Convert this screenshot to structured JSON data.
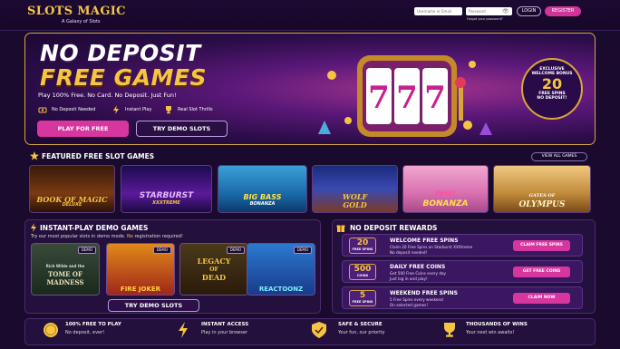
{
  "header": {
    "logo_title": "SLOTS MAGIC",
    "logo_sub": "A Galaxy of Slots",
    "username_placeholder": "Username or Email",
    "password_placeholder": "Password",
    "forgot": "Forgot your password?",
    "login": "LOGIN",
    "register": "REGISTER"
  },
  "hero": {
    "title1": "NO DEPOSIT",
    "title2": "FREE GAMES",
    "subtitle": "Play 100% Free. No Card. No Deposit. Just Fun!",
    "features": [
      "No Deposit Needed",
      "Instant Play",
      "Real Slot Thrills"
    ],
    "play_btn": "PLAY FOR FREE",
    "demo_btn": "TRY DEMO SLOTS",
    "bonus": {
      "l1": "EXCLUSIVE",
      "l2": "WELCOME BONUS",
      "num": "20",
      "l3": "FREE SPINS",
      "l4": "NO DEPOSIT!"
    }
  },
  "featured": {
    "title": "FEATURED FREE SLOT GAMES",
    "view_all": "VIEW ALL GAMES",
    "games": [
      "BOOK OF MAGIC",
      "DELUXE",
      "STARBURST",
      "XXXTREME",
      "BIG BASS",
      "BONANZA",
      "WOLF",
      "GOLD",
      "SWEET",
      "BONANZA",
      "GATES OF",
      "OLYMPUS"
    ]
  },
  "demo": {
    "title": "INSTANT-PLAY DEMO GAMES",
    "desc_a": "Try our most popular slots in demo mode.",
    "desc_no": "No",
    "desc_b": "registration required!",
    "tag": "DEMO",
    "games": [
      "TOME OF",
      "MADNESS",
      "FIRE JOKER",
      "LEGACY",
      "OF",
      "DEAD",
      "REACTOONZ",
      "Rich Wilde and the"
    ],
    "try_btn": "TRY DEMO SLOTS"
  },
  "rewards": {
    "title": "NO DEPOSIT REWARDS",
    "items": [
      {
        "num": "20",
        "unit": "FREE SPINS",
        "title": "WELCOME FREE SPINS",
        "l1": "Claim 20 Free Spins on Starburst XXXtreme",
        "l2": "No deposit needed!",
        "btn": "CLAIM FREE SPINS"
      },
      {
        "num": "500",
        "unit": "COINS",
        "title": "DAILY FREE COINS",
        "l1": "Get 500 Free Coins every day",
        "l2": "Just log in and play!",
        "btn": "GET FREE COINS"
      },
      {
        "num": "5",
        "unit": "FREE SPINS",
        "title": "WEEKEND FREE SPINS",
        "l1": "5 Free Spins every weekend",
        "l2": "On selected games!",
        "btn": "CLAIM NOW"
      }
    ]
  },
  "bottom": [
    {
      "title": "100% FREE TO PLAY",
      "desc": "No deposit, ever!"
    },
    {
      "title": "INSTANT ACCESS",
      "desc": "Play in your browser"
    },
    {
      "title": "SAFE & SECURE",
      "desc": "Your fun, our priority"
    },
    {
      "title": "THOUSANDS OF WINS",
      "desc": "Your next win awaits!"
    }
  ],
  "colors": {
    "accent_pink": "#d7369f",
    "gold": "#f5c542",
    "bg": "#1a0b2e"
  }
}
